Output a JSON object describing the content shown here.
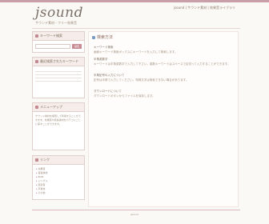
{
  "header": {
    "logo": "jsound",
    "tagline": "サウンド素材・フリー効果音",
    "links": "jsound | サウンド素材 | 効果音ライブラリ"
  },
  "sidebar": {
    "search": {
      "title": "キーワード検索",
      "placeholder": "",
      "button": "検索"
    },
    "ranking": {
      "title": "最近検索されたキーワード"
    },
    "menu": {
      "title": "メニューアップ",
      "text": "サウンド素材を検索して利用することができます。効果音や音楽素材をカテゴリごとに探すことができます。"
    },
    "links": {
      "title": "リンク",
      "items": [
        "効果音",
        "音楽素材",
        "BGM",
        "ジングル",
        "環境音",
        "声素材",
        "その他"
      ]
    }
  },
  "main": {
    "title": "検索方法",
    "sections": [
      {
        "title": "キーワード検索",
        "body": "画面キーワード検索ボックスにキーワードを入力して検索します。"
      },
      {
        "title": "半角英数字",
        "body": "キーワードは半角英数字で入力して下さい。複数キーワードはスペースで区切って入力することができます。"
      },
      {
        "title": "半角記号の入力について",
        "body": "記号は半角で入力してください。特殊文字は検索できない場合があります。"
      },
      {
        "title": "ダウンロードについて",
        "body": "ダウンロードボタンからファイルを保存します。"
      }
    ]
  },
  "footer": {
    "text": "jsound"
  }
}
